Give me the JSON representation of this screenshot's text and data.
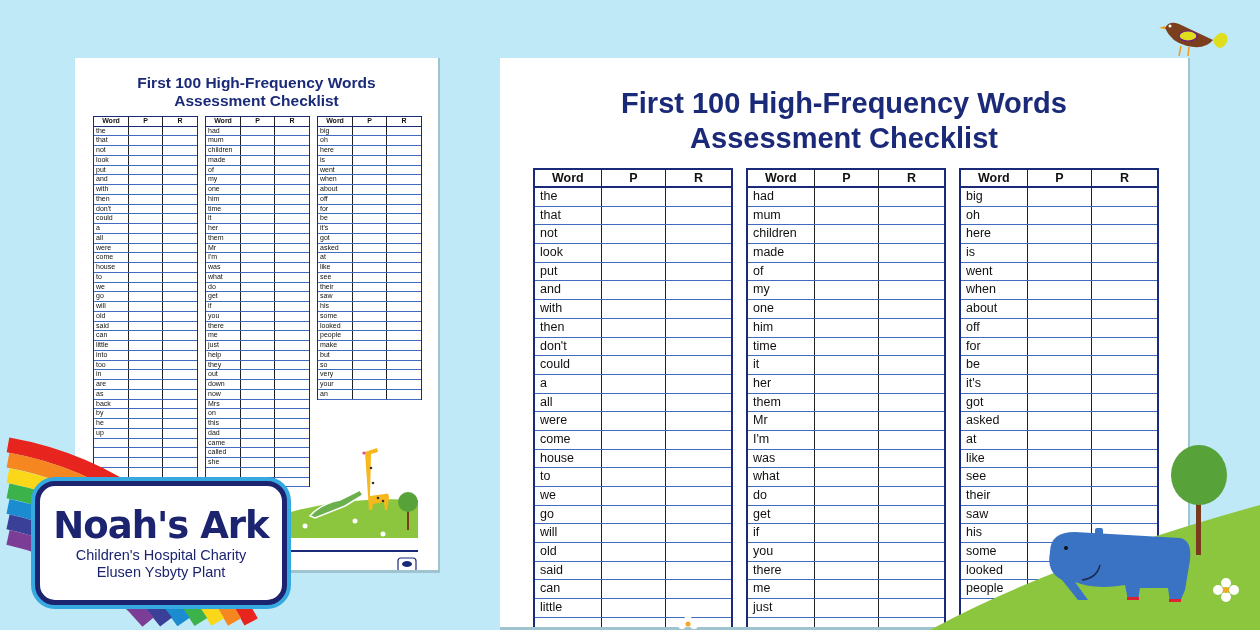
{
  "small_sheet": {
    "title_lines": [
      "First 100 High-Frequency Words",
      "Assessment Checklist"
    ],
    "tables": [
      {
        "columns": [
          "Word",
          "P",
          "R"
        ],
        "continues": true,
        "words": [
          "the",
          "that",
          "not",
          "look",
          "put",
          "and",
          "with",
          "then",
          "don't",
          "could",
          "a",
          "all",
          "were",
          "come",
          "house",
          "to",
          "we",
          "go",
          "will",
          "old",
          "said",
          "can",
          "little",
          "into",
          "too",
          "in",
          "are",
          "as",
          "back",
          "by",
          "he",
          "up"
        ]
      },
      {
        "columns": [
          "Word",
          "P",
          "R"
        ],
        "continues": true,
        "words": [
          "had",
          "mum",
          "children",
          "made",
          "of",
          "my",
          "one",
          "him",
          "time",
          "it",
          "her",
          "them",
          "Mr",
          "I'm",
          "was",
          "what",
          "do",
          "get",
          "if",
          "you",
          "there",
          "me",
          "just",
          "help",
          "they",
          "out",
          "down",
          "now",
          "Mrs",
          "on",
          "this",
          "dad",
          "came",
          "called",
          "she"
        ]
      },
      {
        "columns": [
          "Word",
          "P",
          "R"
        ],
        "continues": false,
        "words": [
          "big",
          "oh",
          "here",
          "is",
          "went",
          "when",
          "about",
          "off",
          "for",
          "be",
          "it's",
          "got",
          "asked",
          "at",
          "like",
          "see",
          "their",
          "saw",
          "his",
          "some",
          "looked",
          "people",
          "make",
          "but",
          "so",
          "very",
          "your",
          "an"
        ]
      }
    ]
  },
  "large_sheet": {
    "title_lines": [
      "First 100 High-Frequency Words",
      "Assessment Checklist"
    ],
    "tables": [
      {
        "columns": [
          "Word",
          "P",
          "R"
        ],
        "continues": true,
        "words": [
          "the",
          "that",
          "not",
          "look",
          "put",
          "and",
          "with",
          "then",
          "don't",
          "could",
          "a",
          "all",
          "were",
          "come",
          "house",
          "to",
          "we",
          "go",
          "will",
          "old",
          "said",
          "can",
          "little"
        ]
      },
      {
        "columns": [
          "Word",
          "P",
          "R"
        ],
        "continues": true,
        "words": [
          "had",
          "mum",
          "children",
          "made",
          "of",
          "my",
          "one",
          "him",
          "time",
          "it",
          "her",
          "them",
          "Mr",
          "I'm",
          "was",
          "what",
          "do",
          "get",
          "if",
          "you",
          "there",
          "me",
          "just"
        ]
      },
      {
        "columns": [
          "Word",
          "P",
          "R"
        ],
        "continues": true,
        "words": [
          "big",
          "oh",
          "here",
          "is",
          "went",
          "when",
          "about",
          "off",
          "for",
          "be",
          "it's",
          "got",
          "asked",
          "at",
          "like",
          "see",
          "their",
          "saw",
          "his",
          "some",
          "looked",
          "people"
        ]
      }
    ]
  },
  "logo": {
    "name": "Noah's Ark",
    "lines": [
      "Children's Hospital Charity",
      "Elusen Ysbyty Plant"
    ]
  }
}
